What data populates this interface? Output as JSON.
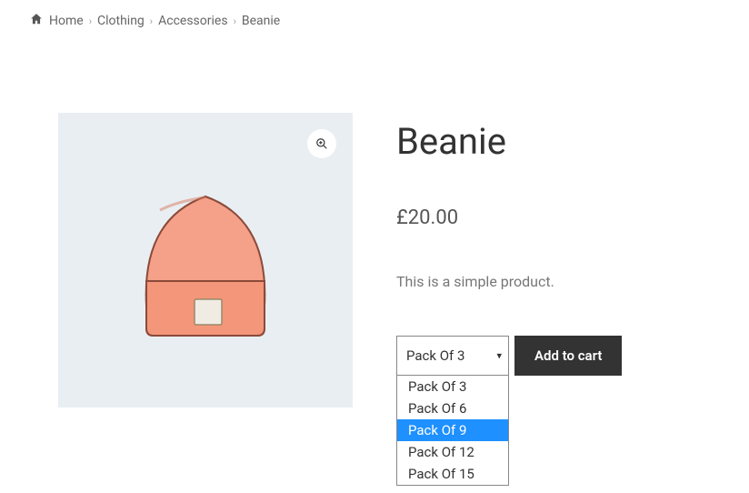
{
  "breadcrumb": {
    "items": [
      {
        "label": "Home"
      },
      {
        "label": "Clothing"
      },
      {
        "label": "Accessories"
      },
      {
        "label": "Beanie"
      }
    ]
  },
  "product": {
    "title": "Beanie",
    "price": "£20.00",
    "description": "This is a simple product.",
    "pack_selected": "Pack Of 3",
    "pack_options": [
      {
        "label": "Pack Of 3",
        "highlighted": false
      },
      {
        "label": "Pack Of 6",
        "highlighted": false
      },
      {
        "label": "Pack Of 9",
        "highlighted": true
      },
      {
        "label": "Pack Of 12",
        "highlighted": false
      },
      {
        "label": "Pack Of 15",
        "highlighted": false
      }
    ],
    "add_to_cart_label": "Add to cart"
  }
}
